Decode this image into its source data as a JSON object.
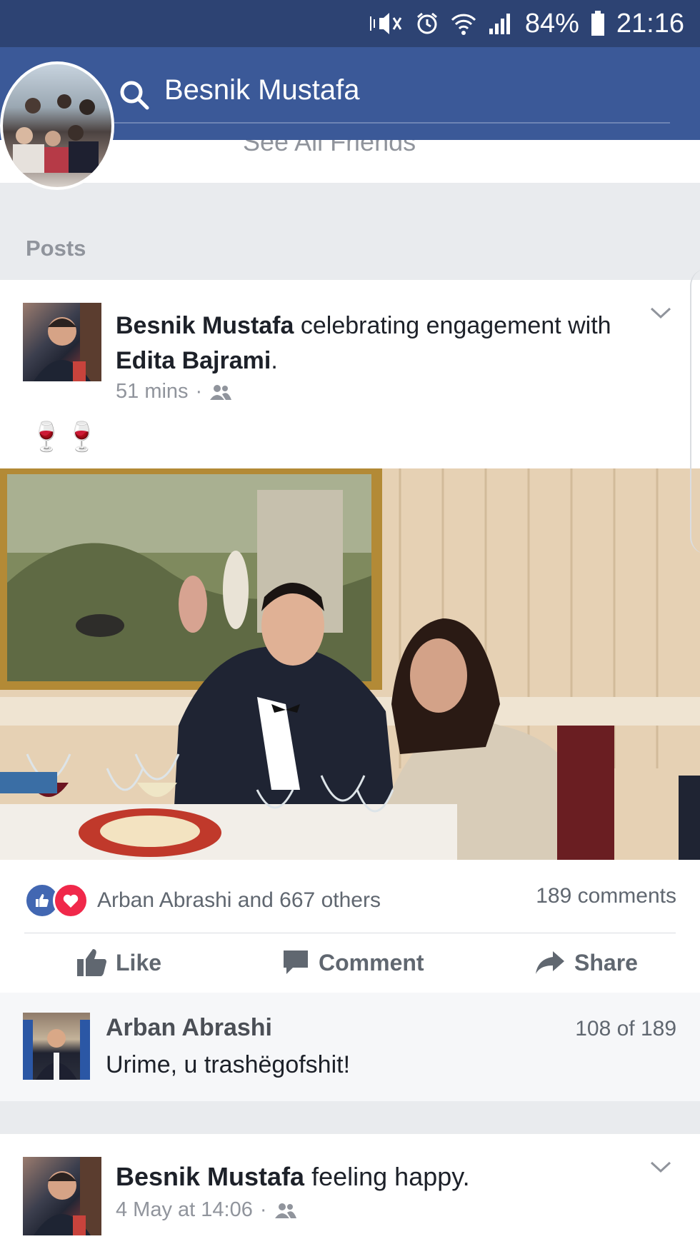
{
  "status_bar": {
    "battery": "84%",
    "time": "21:16",
    "icons": [
      "mute-icon",
      "alarm-icon",
      "wifi-icon",
      "signal-icon",
      "battery-icon"
    ]
  },
  "header": {
    "search_text": "Besnik Mustafa",
    "see_all_friends": "See All Friends"
  },
  "posts_section": {
    "title": "Posts"
  },
  "post1": {
    "author": "Besnik Mustafa",
    "activity": "celebrating engagement with",
    "tagged": "Edita Bajrami",
    "period": ".",
    "time": "51 mins",
    "emoji": "🍷🍷",
    "reactions_text": "Arban Abrashi and 667 others",
    "comments_count": "189 comments",
    "actions": {
      "like": "Like",
      "comment": "Comment",
      "share": "Share"
    },
    "comment": {
      "author": "Arban Abrashi",
      "text": "Urime, u trashëgofshit!",
      "position": "108 of 189"
    }
  },
  "post2": {
    "author": "Besnik Mustafa",
    "activity": "feeling happy.",
    "time": "4 May at 14:06"
  },
  "colors": {
    "status_bar": "#2d4373",
    "header": "#3b5998",
    "like_blue": "#4267b2",
    "love_red": "#f0284a"
  }
}
